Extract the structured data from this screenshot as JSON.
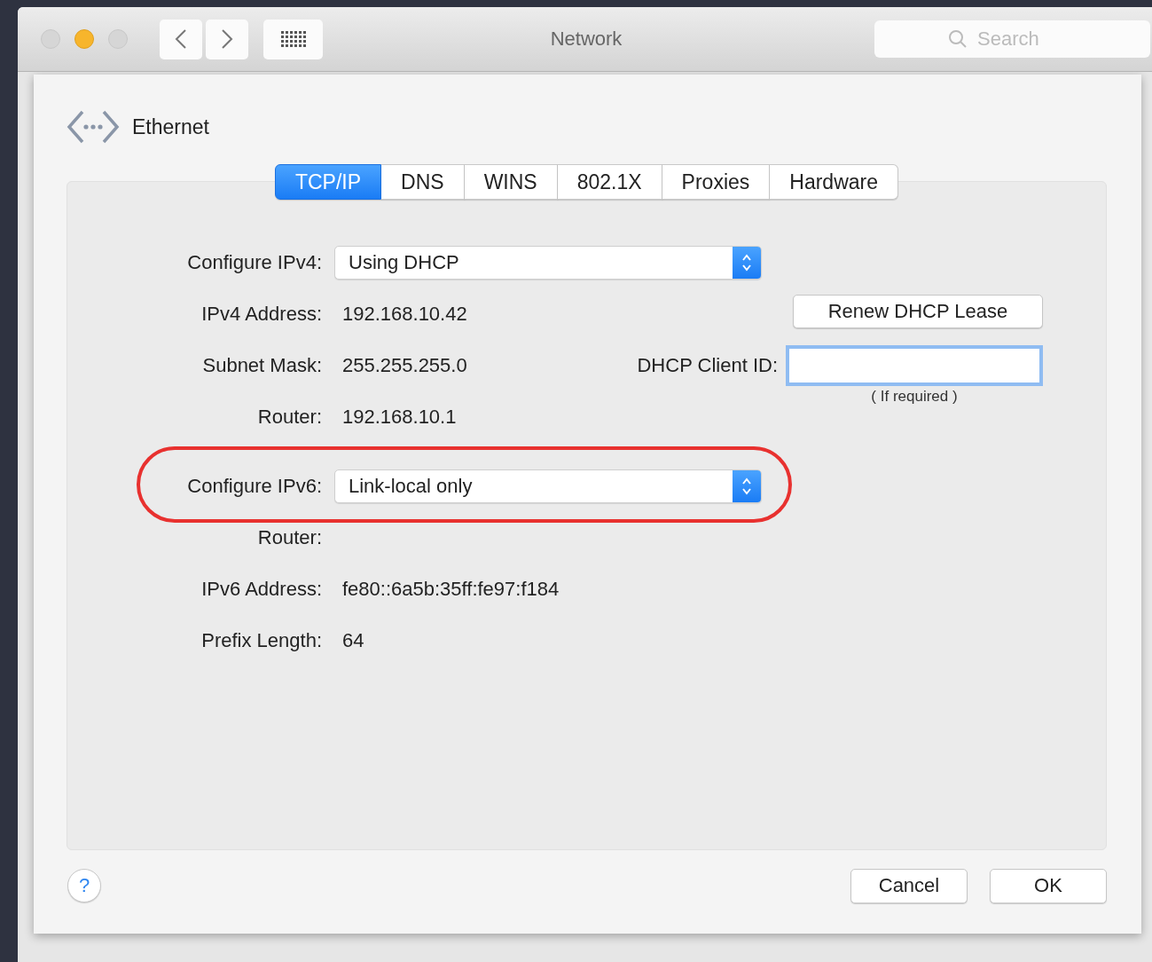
{
  "window": {
    "title": "Network",
    "search": {
      "placeholder": "Search"
    }
  },
  "header": {
    "title": "Ethernet"
  },
  "tabs": [
    {
      "label": "TCP/IP",
      "selected": true
    },
    {
      "label": "DNS",
      "selected": false
    },
    {
      "label": "WINS",
      "selected": false
    },
    {
      "label": "802.1X",
      "selected": false
    },
    {
      "label": "Proxies",
      "selected": false
    },
    {
      "label": "Hardware",
      "selected": false
    }
  ],
  "rows": [
    {
      "kind": "popup",
      "label": "Configure IPv4:",
      "value": "Using DHCP"
    },
    {
      "kind": "text",
      "label": "IPv4 Address:",
      "value": "192.168.10.42",
      "side": {
        "kind": "button",
        "label": "Renew DHCP Lease"
      }
    },
    {
      "kind": "text",
      "label": "Subnet Mask:",
      "value": "255.255.255.0",
      "side": {
        "kind": "field",
        "label": "DHCP Client ID:"
      }
    },
    {
      "kind": "text",
      "label": "Router:",
      "value": "192.168.10.1",
      "side": {
        "kind": "caption",
        "text": "( If required )"
      }
    },
    {
      "kind": "popup",
      "label": "Configure IPv6:",
      "value": "Link-local only",
      "highlighted": true
    },
    {
      "kind": "text",
      "label": "Router:"
    },
    {
      "kind": "text",
      "label": "IPv6 Address:",
      "value": "fe80::6a5b:35ff:fe97:f184"
    },
    {
      "kind": "text",
      "label": "Prefix Length:",
      "value": "64"
    }
  ],
  "help_button": "?",
  "buttons": [
    "Cancel",
    "OK"
  ]
}
